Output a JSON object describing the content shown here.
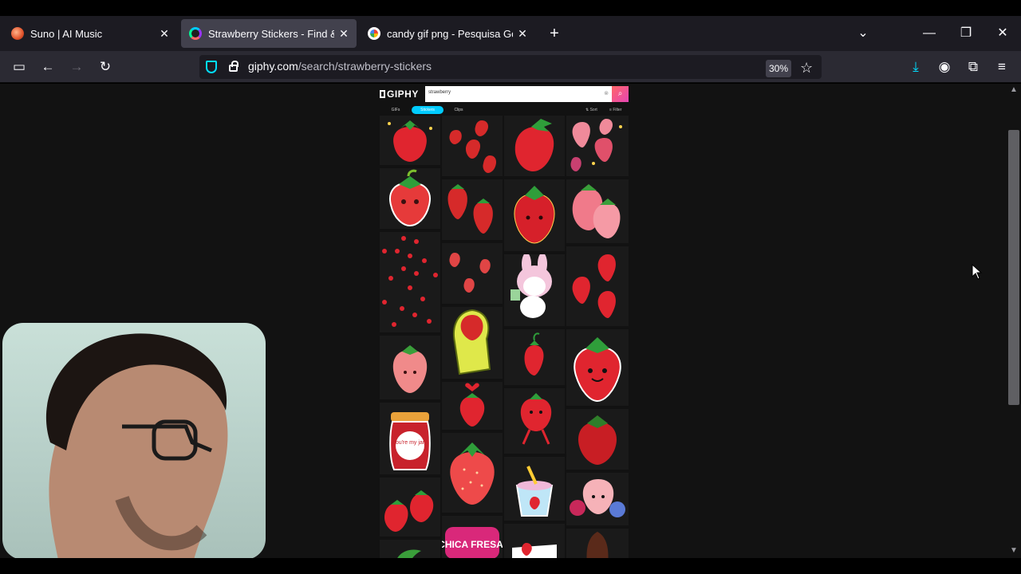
{
  "browser": {
    "tabs": [
      {
        "title": "Suno | AI Music",
        "active": false,
        "favicon": "suno-icon"
      },
      {
        "title": "Strawberry Stickers - Find & Sh",
        "active": true,
        "favicon": "giphy-icon"
      },
      {
        "title": "candy gif png - Pesquisa Googl",
        "active": false,
        "favicon": "google-icon"
      }
    ],
    "url_domain": "giphy.com",
    "url_path": "/search/strawberry-stickers",
    "zoom": "30%"
  },
  "giphy": {
    "logo": "GIPHY",
    "search_value": "strawberry",
    "tabs": [
      "GIFs",
      "Stickers",
      "Clips"
    ],
    "active_tab": "Stickers",
    "sort_label": "Sort",
    "filter_label": "Filter"
  },
  "stickers": {
    "text_1": "you're my jam",
    "text_2": "CHICA FRESA"
  },
  "colors": {
    "accent": "#00ccff",
    "strawberry": "#e0252f",
    "leaf": "#2f9e3a"
  }
}
